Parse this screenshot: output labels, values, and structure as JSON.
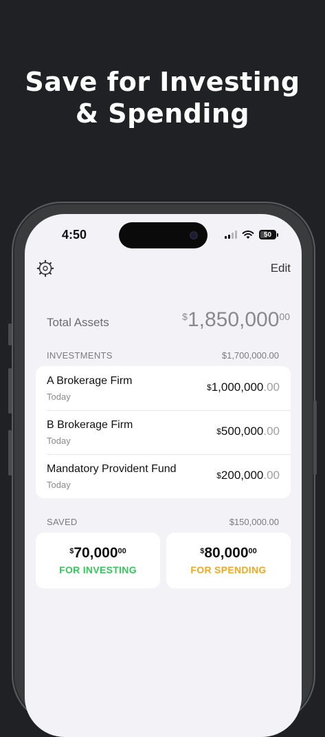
{
  "headline": {
    "line1": "Save for Investing",
    "line2": "& Spending"
  },
  "status_bar": {
    "time": "4:50",
    "battery": "50"
  },
  "nav": {
    "settings_icon": "gear-icon",
    "edit_label": "Edit"
  },
  "total": {
    "label": "Total Assets",
    "currency": "$",
    "value": "1,850,000",
    "cents": "00"
  },
  "investments": {
    "label": "INVESTMENTS",
    "total": "$1,700,000.00",
    "items": [
      {
        "name": "A Brokerage Firm",
        "date": "Today",
        "currency": "$",
        "value": "1,000,000",
        "cents": ".00"
      },
      {
        "name": "B Brokerage Firm",
        "date": "Today",
        "currency": "$",
        "value": "500,000",
        "cents": ".00"
      },
      {
        "name": "Mandatory Provident Fund",
        "date": "Today",
        "currency": "$",
        "value": "200,000",
        "cents": ".00"
      }
    ]
  },
  "saved": {
    "label": "SAVED",
    "total": "$150,000.00",
    "investing": {
      "currency": "$",
      "value": "70,000",
      "cents": "00",
      "tag": "FOR INVESTING",
      "color": "#34c759"
    },
    "spending": {
      "currency": "$",
      "value": "80,000",
      "cents": "00",
      "tag": "FOR SPENDING",
      "color": "#f5a623"
    }
  }
}
